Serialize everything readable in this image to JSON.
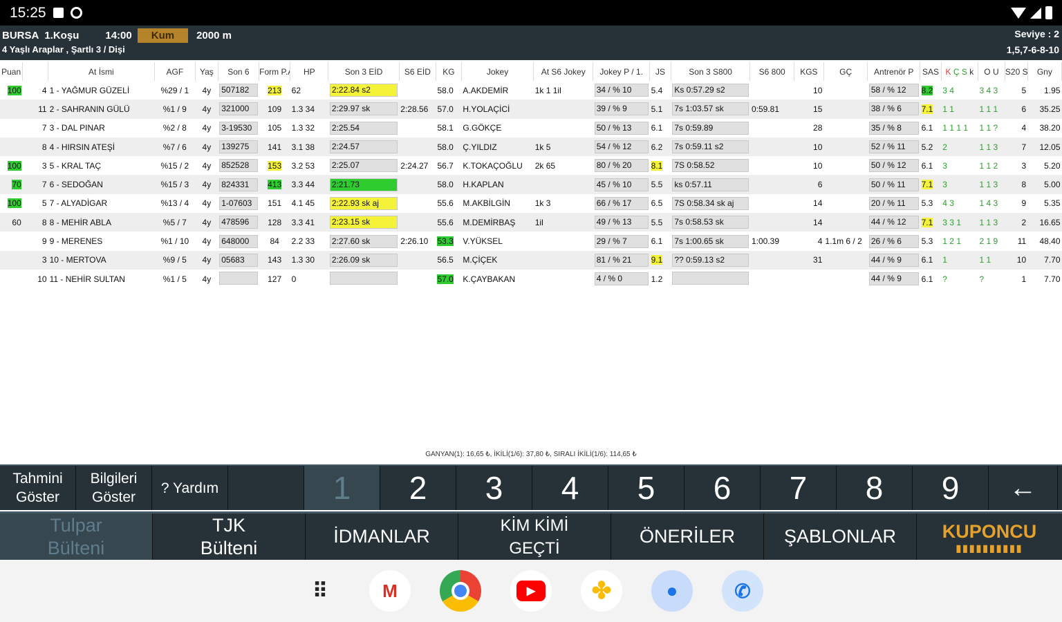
{
  "status_bar": {
    "time": "15:25"
  },
  "race": {
    "city": "BURSA",
    "race_no": "1.Koşu",
    "time": "14:00",
    "surface": "Kum",
    "distance": "2000 m",
    "conditions": "4 Yaşlı Araplar , Şartlı 3 / Dişi",
    "level_label": "Seviye : 2",
    "sequence": "1,5,7-6-8-10"
  },
  "columns": [
    "Puan",
    "At İsmi",
    "AGF",
    "Yaş",
    "Son 6",
    "Form P.AS",
    "HP",
    "Son 3 EİD",
    "S6 EİD",
    "KG",
    "Jokey",
    "At S6 Jokey",
    "Jokey P / 1.",
    "JS",
    "Son 3 S800",
    "S6 800",
    "KGS",
    "GÇ",
    "Antrenör P",
    "SAS",
    "K",
    "Ç",
    "S",
    "k",
    "O",
    "U",
    "S20",
    "St",
    "Gny"
  ],
  "rows": [
    {
      "puan": "100",
      "no": "4",
      "name": "1 - YAĞMUR GÜZELİ",
      "agf": "%29 / 1",
      "age": "4y",
      "son6": "507182",
      "form": "213",
      "hp": "62",
      "eid": "2:22.84 s2",
      "s6eid": "",
      "kg": "58.0",
      "jokey": "A.AKDEMİR",
      "ats6": "1k 1 1il",
      "jp": "34 / % 10",
      "js": "5.4",
      "s800": "Ks 0:57.29 s2",
      "s6800": "",
      "kgs": "10",
      "gc": "",
      "antp": "58 / % 12",
      "sas": "8.2",
      "ko": "3 4",
      "uo": "3 4 3",
      "st": "5",
      "gny": "1.95"
    },
    {
      "puan": "",
      "no": "11",
      "name": "2 - SAHRANIN GÜLÜ",
      "agf": "%1 / 9",
      "age": "4y",
      "son6": "321000",
      "form": "109",
      "hp": "1.3 34",
      "eid": "2:29.97 sk",
      "s6eid": "2:28.56",
      "kg": "57.0",
      "jokey": "H.YOLAÇİCİ",
      "ats6": "",
      "jp": "39 / % 9",
      "js": "5.1",
      "s800": "7s 1:03.57 sk",
      "s6800": "0:59.81",
      "kgs": "15",
      "gc": "",
      "antp": "38 / % 6",
      "sas": "7.1",
      "ko": "1 1",
      "uo": "1 1 1",
      "st": "6",
      "gny": "35.25"
    },
    {
      "puan": "",
      "no": "7",
      "name": "3 - DAL PINAR",
      "agf": "%2 / 8",
      "age": "4y",
      "son6": "3-19530",
      "form": "105",
      "hp": "1.3 32",
      "eid": "2:25.54",
      "s6eid": "",
      "kg": "58.1",
      "jokey": "G.GÖKÇE",
      "ats6": "",
      "jp": "50 / % 13",
      "js": "6.1",
      "s800": "7s 0:59.89",
      "s6800": "",
      "kgs": "28",
      "gc": "",
      "antp": "35 / % 8",
      "sas": "6.1",
      "ko": "1 1 1 1",
      "uo": "1 1 ?",
      "st": "4",
      "gny": "38.20"
    },
    {
      "puan": "",
      "no": "8",
      "name": "4 - HIRSIN ATEŞİ",
      "agf": "%7 / 6",
      "age": "4y",
      "son6": "139275",
      "form": "141",
      "hp": "3.1 38",
      "eid": "2:24.57",
      "s6eid": "",
      "kg": "58.0",
      "jokey": "Ç.YILDIZ",
      "ats6": "1k 5",
      "jp": "54 / % 12",
      "js": "6.2",
      "s800": "7s 0:59.11 s2",
      "s6800": "",
      "kgs": "10",
      "gc": "",
      "antp": "52 / % 11",
      "sas": "5.2",
      "ko": "2",
      "uo": "1 1 3",
      "st": "7",
      "gny": "12.05"
    },
    {
      "puan": "100",
      "no": "3",
      "name": "5 - KRAL TAÇ",
      "agf": "%15 / 2",
      "age": "4y",
      "son6": "852528",
      "form": "153",
      "hp": "3.2 53",
      "eid": "2:25.07",
      "s6eid": "2:24.27",
      "kg": "56.7",
      "jokey": "K.TOKAÇOĞLU",
      "ats6": "2k 65",
      "jp": "80 / % 20",
      "js": "8.1",
      "s800": "7S 0:58.52",
      "s6800": "",
      "kgs": "10",
      "gc": "",
      "antp": "50 / % 12",
      "sas": "6.1",
      "ko": "3",
      "uo": "1 1 2",
      "st": "3",
      "gny": "5.20"
    },
    {
      "puan": "70",
      "no": "7",
      "name": "6 - SEDOĞAN",
      "agf": "%15 / 3",
      "age": "4y",
      "son6": "824331",
      "form": "413",
      "hp": "3.3 44",
      "eid": "2:21.73",
      "s6eid": "",
      "kg": "58.0",
      "jokey": "H.KAPLAN",
      "ats6": "",
      "jp": "45 / % 10",
      "js": "5.5",
      "s800": "ks 0:57.11",
      "s6800": "",
      "kgs": "6",
      "gc": "",
      "antp": "50 / % 11",
      "sas": "7.1",
      "ko": "3",
      "uo": "1 1 3",
      "st": "8",
      "gny": "5.00"
    },
    {
      "puan": "100",
      "no": "5",
      "name": "7 - ALYADİGAR",
      "agf": "%13 / 4",
      "age": "4y",
      "son6": "1-07603",
      "form": "151",
      "hp": "4.1 45",
      "eid": "2:22.93 sk aj",
      "s6eid": "",
      "kg": "55.6",
      "jokey": "M.AKBİLGİN",
      "ats6": "1k 3",
      "jp": "66 / % 17",
      "js": "6.5",
      "s800": "7S 0:58.34 sk aj",
      "s6800": "",
      "kgs": "14",
      "gc": "",
      "antp": "20 / % 11",
      "sas": "5.3",
      "ko": "4 3",
      "uo": "1 4 3",
      "st": "9",
      "gny": "5.35"
    },
    {
      "puan": "60",
      "no": "8",
      "name": "8 - MEHİR ABLA",
      "agf": "%5 / 7",
      "age": "4y",
      "son6": "478596",
      "form": "128",
      "hp": "3.3 41",
      "eid": "2:23.15 sk",
      "s6eid": "",
      "kg": "55.6",
      "jokey": "M.DEMİRBAŞ",
      "ats6": "1il",
      "jp": "49 / % 13",
      "js": "5.5",
      "s800": "7s 0:58.53 sk",
      "s6800": "",
      "kgs": "14",
      "gc": "",
      "antp": "44 / % 12",
      "sas": "7.1",
      "ko": "3 3 1",
      "uo": "1 1 3",
      "st": "2",
      "gny": "16.65"
    },
    {
      "puan": "",
      "no": "9",
      "name": "9 - MERENES",
      "agf": "%1 / 10",
      "age": "4y",
      "son6": "648000",
      "form": "84",
      "hp": "2.2 33",
      "eid": "2:27.60 sk",
      "s6eid": "2:26.10",
      "kg": "53.3",
      "jokey": "V.YÜKSEL",
      "ats6": "",
      "jp": "29 / % 7",
      "js": "6.1",
      "s800": "7s 1:00.65 sk",
      "s6800": "1:00.39",
      "kgs": "4",
      "gc": "1.1m 6 / 2",
      "antp": "26 / % 6",
      "sas": "5.3",
      "ko": "1 2 1",
      "uo": "2 1 9",
      "st": "11",
      "gny": "48.40"
    },
    {
      "puan": "",
      "no": "3",
      "name": "10 - MERTOVA",
      "agf": "%9 / 5",
      "age": "4y",
      "son6": "05683",
      "form": "143",
      "hp": "1.3 30",
      "eid": "2:26.09 sk",
      "s6eid": "",
      "kg": "56.5",
      "jokey": "M.ÇİÇEK",
      "ats6": "",
      "jp": "81 / % 21",
      "js": "9.1",
      "s800": "?? 0:59.13 s2",
      "s6800": "",
      "kgs": "31",
      "gc": "",
      "antp": "44 / % 9",
      "sas": "6.1",
      "ko": "1",
      "uo": "1 1",
      "st": "10",
      "gny": "7.70"
    },
    {
      "puan": "",
      "no": "10",
      "name": "11 - NEHİR SULTAN",
      "agf": "%1 / 5",
      "age": "4y",
      "son6": "",
      "form": "127",
      "hp": "0",
      "eid": "",
      "s6eid": "",
      "kg": "57.0",
      "jokey": "K.ÇAYBAKAN",
      "ats6": "",
      "jp": "4 / % 0",
      "js": "1.2",
      "s800": "",
      "s6800": "",
      "kgs": "",
      "gc": "",
      "antp": "44 / % 9",
      "sas": "6.1",
      "ko": "?",
      "uo": "?",
      "st": "1",
      "gny": "7.70"
    }
  ],
  "bet_summary": "GANYAN(1): 16,65 ₺, İKİLİ(1/6): 37,80 ₺, SIRALI İKİLİ(1/6): 114,65 ₺",
  "keypad": {
    "tahmini": "Tahmini Göster",
    "bilgileri": "Bilgileri Göster",
    "yardim": "? Yardım",
    "numbers": [
      "1",
      "2",
      "3",
      "4",
      "5",
      "6",
      "7",
      "8",
      "9"
    ],
    "back": "←"
  },
  "tabs": [
    "Tulpar Bülteni",
    "TJK Bülteni",
    "İDMANLAR",
    "KİM KİMİ GEÇTİ",
    "ÖNERİLER",
    "ŞABLONLAR",
    "KUPONCU"
  ],
  "dock": [
    "apps-grid",
    "gmail",
    "chrome",
    "youtube",
    "photos",
    "messages",
    "phone"
  ]
}
